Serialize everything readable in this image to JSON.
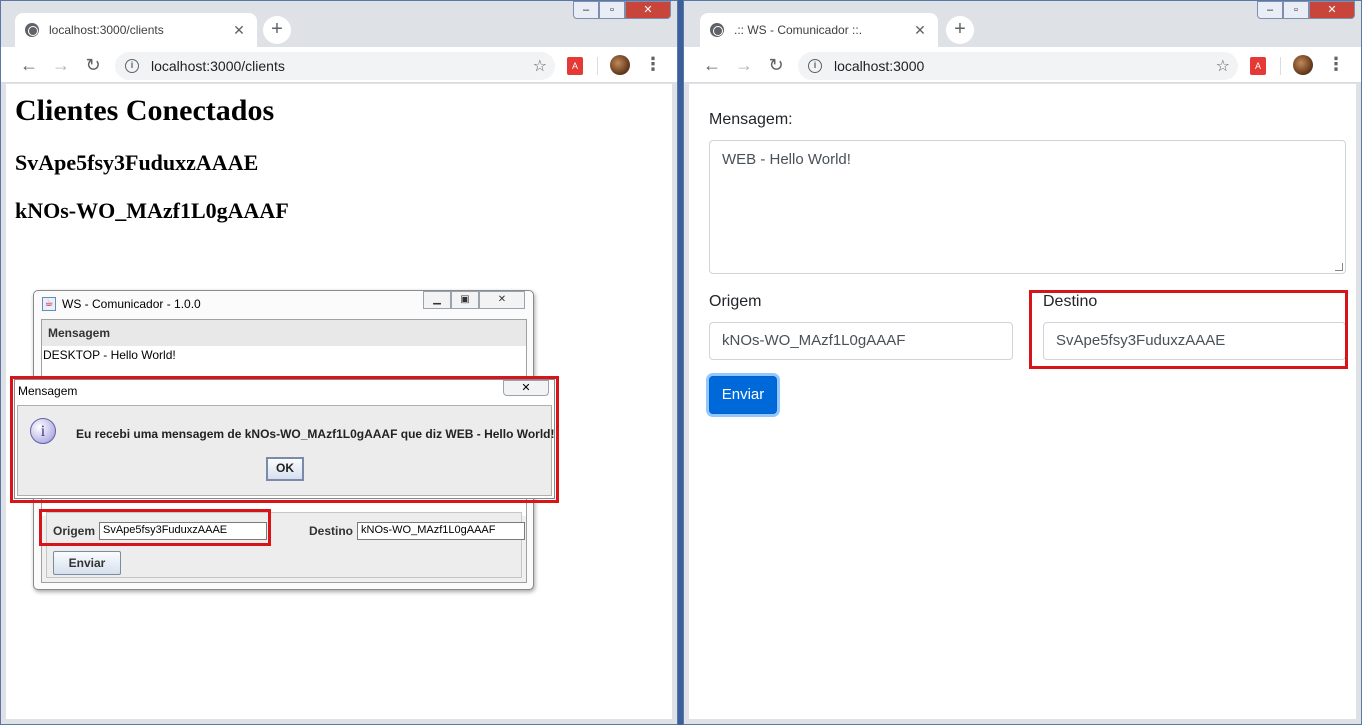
{
  "left_browser": {
    "tab_title": "localhost:3000/clients",
    "url": "localhost:3000/clients",
    "page": {
      "heading": "Clientes Conectados",
      "clients": [
        "SvApe5fsy3FuduxzAAAE",
        "kNOs-WO_MAzf1L0gAAAF"
      ]
    }
  },
  "java_app": {
    "title": "WS - Comunicador - 1.0.0",
    "message_label": "Mensagem",
    "message_text": "DESKTOP - Hello World!",
    "origem_label": "Origem",
    "origem_value": "SvApe5fsy3FuduxzAAAE",
    "destino_label": "Destino",
    "destino_value": "kNOs-WO_MAzf1L0gAAAF",
    "send_label": "Enviar"
  },
  "dialog": {
    "title": "Mensagem",
    "message": "Eu recebi uma mensagem de kNOs-WO_MAzf1L0gAAAF que diz WEB - Hello World!",
    "ok_label": "OK",
    "icon": "info-icon"
  },
  "right_browser": {
    "tab_title": ".:: WS - Comunicador ::.",
    "url": "localhost:3000",
    "form": {
      "message_label": "Mensagem:",
      "message_value": "WEB - Hello World!",
      "origem_label": "Origem",
      "origem_value": "kNOs-WO_MAzf1L0gAAAF",
      "destino_label": "Destino",
      "destino_value": "SvApe5fsy3FuduxzAAAE",
      "send_label": "Enviar"
    }
  },
  "colors": {
    "highlight": "#d6141a",
    "primary_button": "#0069d9"
  }
}
